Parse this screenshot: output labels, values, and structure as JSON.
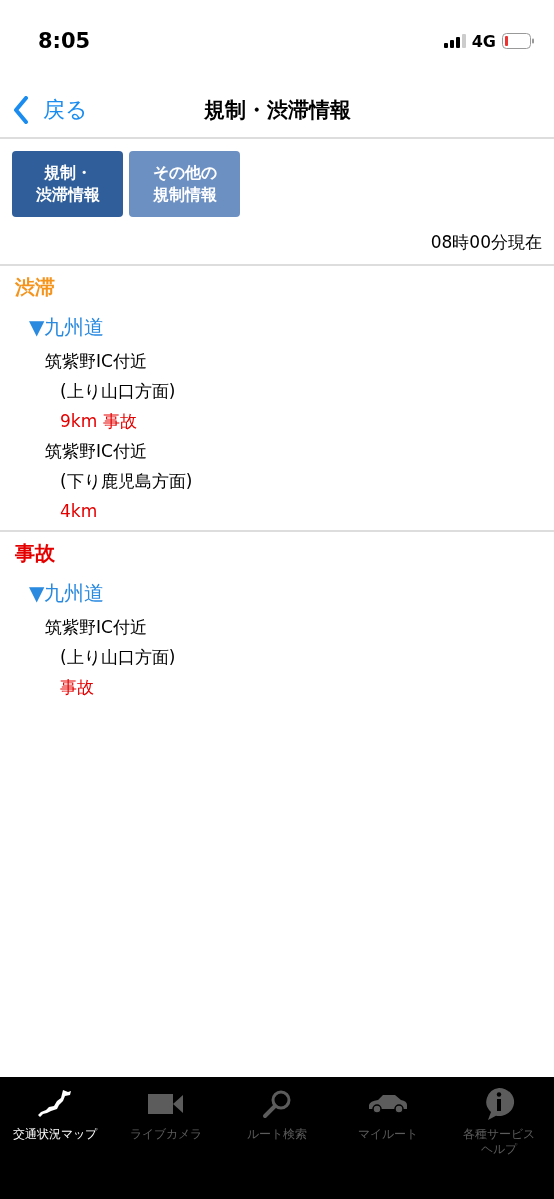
{
  "status_bar": {
    "time": "8:05",
    "network": "4G"
  },
  "nav": {
    "back": "戻る",
    "title": "規制・渋滞情報"
  },
  "tabs": [
    {
      "lines": [
        "規制・",
        "渋滞情報"
      ],
      "selected": true
    },
    {
      "lines": [
        "その他の",
        "規制情報"
      ],
      "selected": false
    }
  ],
  "timestamp": "08時00分現在",
  "sections": [
    {
      "title": "渋滞",
      "kind": "jam",
      "roads": [
        {
          "marker": "▼",
          "name": "九州道",
          "items": [
            {
              "location": "筑紫野IC付近",
              "direction": "(上り山口方面)",
              "detail": "9km 事故"
            },
            {
              "location": "筑紫野IC付近",
              "direction": "(下り鹿児島方面)",
              "detail": "4km"
            }
          ]
        }
      ]
    },
    {
      "title": "事故",
      "kind": "accident",
      "roads": [
        {
          "marker": "▼",
          "name": "九州道",
          "items": [
            {
              "location": "筑紫野IC付近",
              "direction": "(上り山口方面)",
              "detail": "事故"
            }
          ]
        }
      ]
    }
  ],
  "tab_bar": [
    {
      "lines": [
        "交通状況マップ"
      ],
      "selected": true
    },
    {
      "lines": [
        "ライブカメラ"
      ],
      "selected": false
    },
    {
      "lines": [
        "ルート検索"
      ],
      "selected": false
    },
    {
      "lines": [
        "マイルート"
      ],
      "selected": false
    },
    {
      "lines": [
        "各種サービス",
        "ヘルプ"
      ],
      "selected": false
    }
  ]
}
